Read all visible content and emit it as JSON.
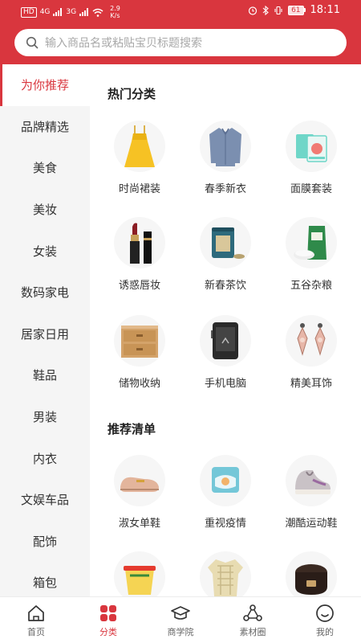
{
  "status_bar": {
    "hd": "HD",
    "net1": "4G",
    "net2": "3G",
    "speed_value": "2.9",
    "speed_unit": "K/s",
    "battery": "61",
    "time": "18:11"
  },
  "search": {
    "placeholder": "输入商品名或粘贴宝贝标题搜索"
  },
  "sidebar": {
    "items": [
      {
        "label": "为你推荐",
        "active": true
      },
      {
        "label": "品牌精选"
      },
      {
        "label": "美食"
      },
      {
        "label": "美妆"
      },
      {
        "label": "女装"
      },
      {
        "label": "数码家电"
      },
      {
        "label": "居家日用"
      },
      {
        "label": "鞋品"
      },
      {
        "label": "男装"
      },
      {
        "label": "内衣"
      },
      {
        "label": "文娱车品"
      },
      {
        "label": "配饰"
      },
      {
        "label": "箱包"
      }
    ]
  },
  "hot": {
    "title": "热门分类",
    "items": [
      {
        "label": "时尚裙装",
        "icon": "dress-icon"
      },
      {
        "label": "春季新衣",
        "icon": "shirt-icon"
      },
      {
        "label": "面膜套装",
        "icon": "mask-box-icon"
      },
      {
        "label": "诱惑唇妆",
        "icon": "lipstick-icon"
      },
      {
        "label": "新春茶饮",
        "icon": "tea-can-icon"
      },
      {
        "label": "五谷杂粮",
        "icon": "rice-bag-icon"
      },
      {
        "label": "储物收纳",
        "icon": "drawer-icon"
      },
      {
        "label": "手机电脑",
        "icon": "phone-icon"
      },
      {
        "label": "精美耳饰",
        "icon": "earrings-icon"
      }
    ]
  },
  "recommend": {
    "title": "推荐清单",
    "items": [
      {
        "label": "淑女单鞋",
        "icon": "loafer-icon"
      },
      {
        "label": "重视疫情",
        "icon": "face-mask-icon"
      },
      {
        "label": "潮酷运动鞋",
        "icon": "sneaker-icon"
      },
      {
        "label": "",
        "icon": "snack-cup-icon"
      },
      {
        "label": "",
        "icon": "pajamas-icon"
      },
      {
        "label": "",
        "icon": "rice-cooker-icon"
      }
    ]
  },
  "tabbar": {
    "items": [
      {
        "label": "首页",
        "icon": "home-icon"
      },
      {
        "label": "分类",
        "icon": "category-icon",
        "active": true
      },
      {
        "label": "商学院",
        "icon": "graduation-cap-icon"
      },
      {
        "label": "素材圈",
        "icon": "material-circle-icon"
      },
      {
        "label": "我的",
        "icon": "profile-face-icon"
      }
    ]
  },
  "colors": {
    "brand": "#d9363e",
    "sidebar_bg": "#f5f5f5"
  }
}
